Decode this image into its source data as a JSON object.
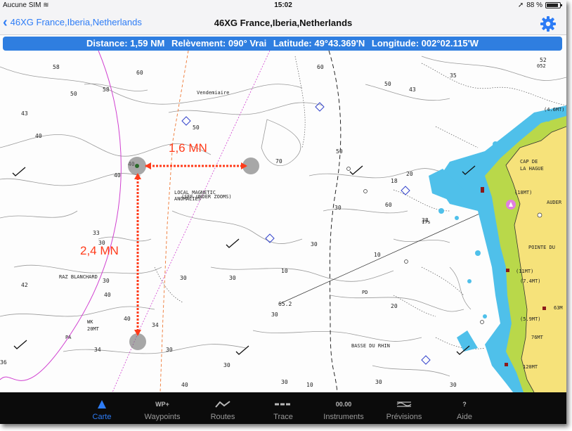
{
  "status_bar": {
    "carrier": "Aucune SIM",
    "time": "15:02",
    "battery": "88 %"
  },
  "nav": {
    "back_label": "46XG France,Iberia,Netherlands",
    "title": "46XG France,Iberia,Netherlands"
  },
  "info_bar": {
    "distance": "Distance: 1,59 NM",
    "bearing": "Relèvement: 090° Vrai",
    "latitude": "Latitude: 49°43.369'N",
    "longitude": "Longitude: 002°02.115'W"
  },
  "measurements": {
    "horizontal": "1,6 MN",
    "vertical": "2,4 MN"
  },
  "map_labels": {
    "vendemiaire": "Vendemiaire",
    "local_magnetic_1": "LOCAL MAGNETIC",
    "local_magnetic_2": "ANOMALIES",
    "see_under": "(SEE UNDER ZOOMS)",
    "raz_blanchard": "RAZ BLANCHARD",
    "basse_du_rhin": "BASSE DU RHIN",
    "wk": "WK",
    "wk_depth": "20MT",
    "pa": "PA",
    "pd": "PD",
    "cap_de_1": "CAP DE",
    "cap_de_2": "LA HAGUE",
    "auderville": "AUDER",
    "pointe_du": "POINTE DU",
    "ht_18": "(18MT)",
    "ht_11": "(11MT)",
    "ht_74": "(7.4MT)",
    "ht_59": "(5.9MT)",
    "ht_63": "63M",
    "ht_76": "76MT",
    "ht_120": "120MT",
    "ht_46": "(4.6MT)",
    "ht_17s": "17s",
    "ht_052": "052"
  },
  "depths": [
    "58",
    "60",
    "52",
    "60",
    "35",
    "43",
    "50",
    "58",
    "50",
    "43",
    "40",
    "50",
    "40",
    "40",
    "70",
    "50",
    "20",
    "18",
    "30",
    "33",
    "10",
    "30",
    "30",
    "30",
    "30",
    "42",
    "30",
    "40",
    "40",
    "34",
    "10",
    "20",
    "30",
    "34",
    "30",
    "30",
    "30",
    "30",
    "10",
    "30",
    "36",
    "40",
    "65.2",
    "60",
    "38"
  ],
  "tabs": [
    {
      "label": "Carte",
      "icon": "▲"
    },
    {
      "label": "Waypoints",
      "icon": "WP+"
    },
    {
      "label": "Routes",
      "icon": "route-icon"
    },
    {
      "label": "Trace",
      "icon": "trace-icon"
    },
    {
      "label": "Instruments",
      "icon": "00.00"
    },
    {
      "label": "Prévisions",
      "icon": "forecast-icon"
    },
    {
      "label": "Aide",
      "icon": "?"
    }
  ],
  "colors": {
    "accent": "#2d7cf6",
    "land": "#f6e27a",
    "green_shore": "#b9d84a",
    "shallow_water": "#4fc0ea",
    "measure": "#ff3b1a"
  }
}
